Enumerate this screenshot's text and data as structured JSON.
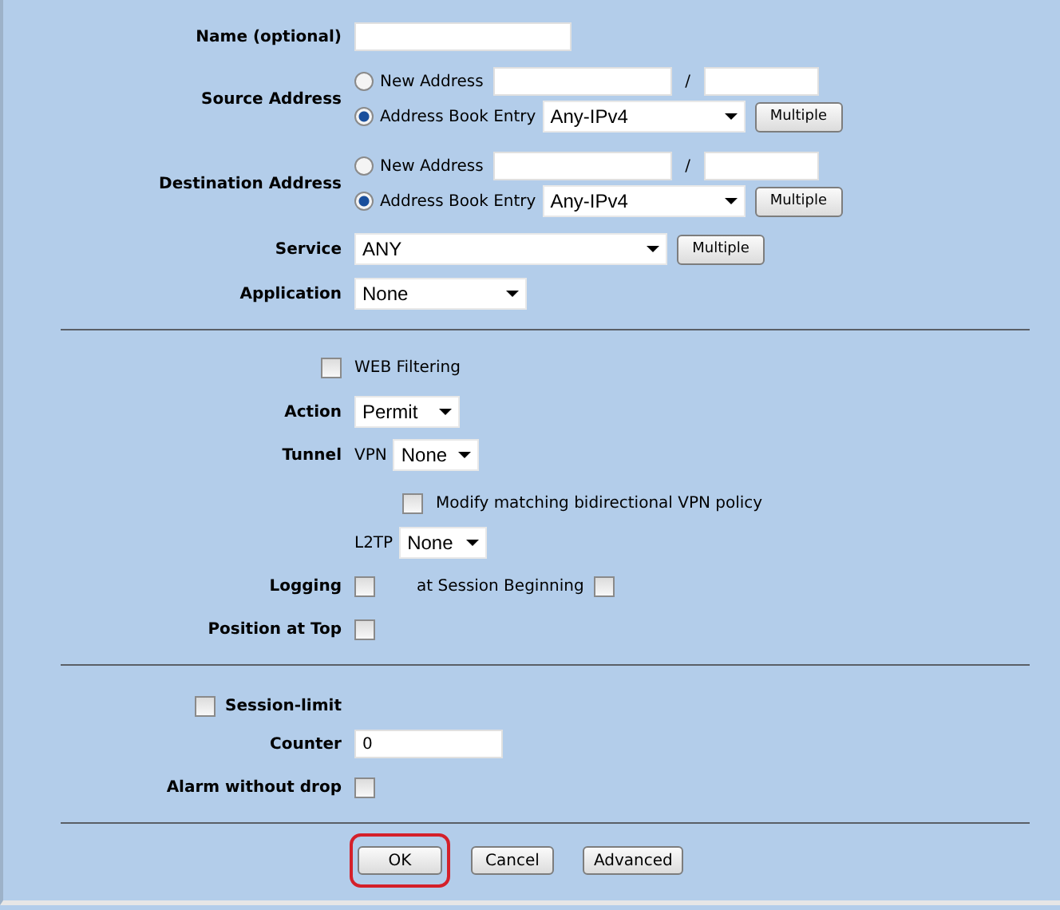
{
  "name_field": {
    "label": "Name (optional)"
  },
  "source_address": {
    "label": "Source Address",
    "new_address": {
      "label": "New Address",
      "selected": false,
      "separator": "/"
    },
    "address_book": {
      "label": "Address Book Entry",
      "selected": true,
      "value": "Any-IPv4"
    },
    "button": "Multiple"
  },
  "destination_address": {
    "label": "Destination Address",
    "new_address": {
      "label": "New Address",
      "selected": false,
      "separator": "/"
    },
    "address_book": {
      "label": "Address Book Entry",
      "selected": true,
      "value": "Any-IPv4"
    },
    "button": "Multiple"
  },
  "service": {
    "label": "Service",
    "value": "ANY",
    "button": "Multiple"
  },
  "application": {
    "label": "Application",
    "value": "None"
  },
  "web_filtering": {
    "label": "WEB Filtering",
    "checked": false
  },
  "action": {
    "label": "Action",
    "value": "Permit"
  },
  "tunnel": {
    "label": "Tunnel",
    "vpn": {
      "label": "VPN",
      "value": "None"
    },
    "modify_policy": {
      "label": "Modify matching bidirectional VPN policy",
      "checked": false
    },
    "l2tp": {
      "label": "L2TP",
      "value": "None"
    }
  },
  "logging": {
    "label": "Logging",
    "checked": false,
    "session_beginning": {
      "label": "at Session Beginning",
      "checked": false
    }
  },
  "position_at_top": {
    "label": "Position at Top",
    "checked": false
  },
  "session_limit": {
    "label": "Session-limit",
    "checked": false
  },
  "counter": {
    "label": "Counter",
    "value": "0"
  },
  "alarm_without_drop": {
    "label": "Alarm without drop",
    "checked": false
  },
  "buttons": [
    {
      "label": "OK",
      "highlighted": true
    },
    {
      "label": "Cancel",
      "highlighted": false
    },
    {
      "label": "Advanced",
      "highlighted": false
    }
  ]
}
